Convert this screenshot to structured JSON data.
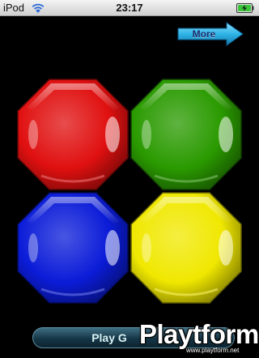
{
  "status_bar": {
    "carrier": "iPod",
    "time": "23:17",
    "wifi_icon": "wifi-icon",
    "battery_icon": "battery-charging-icon"
  },
  "more_button": {
    "label": "More",
    "icon": "arrow-right-icon",
    "color": "#2fb4e6"
  },
  "gems": [
    {
      "name": "gem-red",
      "color": "#e01010"
    },
    {
      "name": "gem-green",
      "color": "#2a9a00"
    },
    {
      "name": "gem-blue",
      "color": "#0b1cd8"
    },
    {
      "name": "gem-yellow",
      "color": "#f0e800"
    }
  ],
  "play_button": {
    "label": "Play G"
  },
  "watermark": {
    "logo": "Playtform",
    "url": "www.playtform.net"
  }
}
